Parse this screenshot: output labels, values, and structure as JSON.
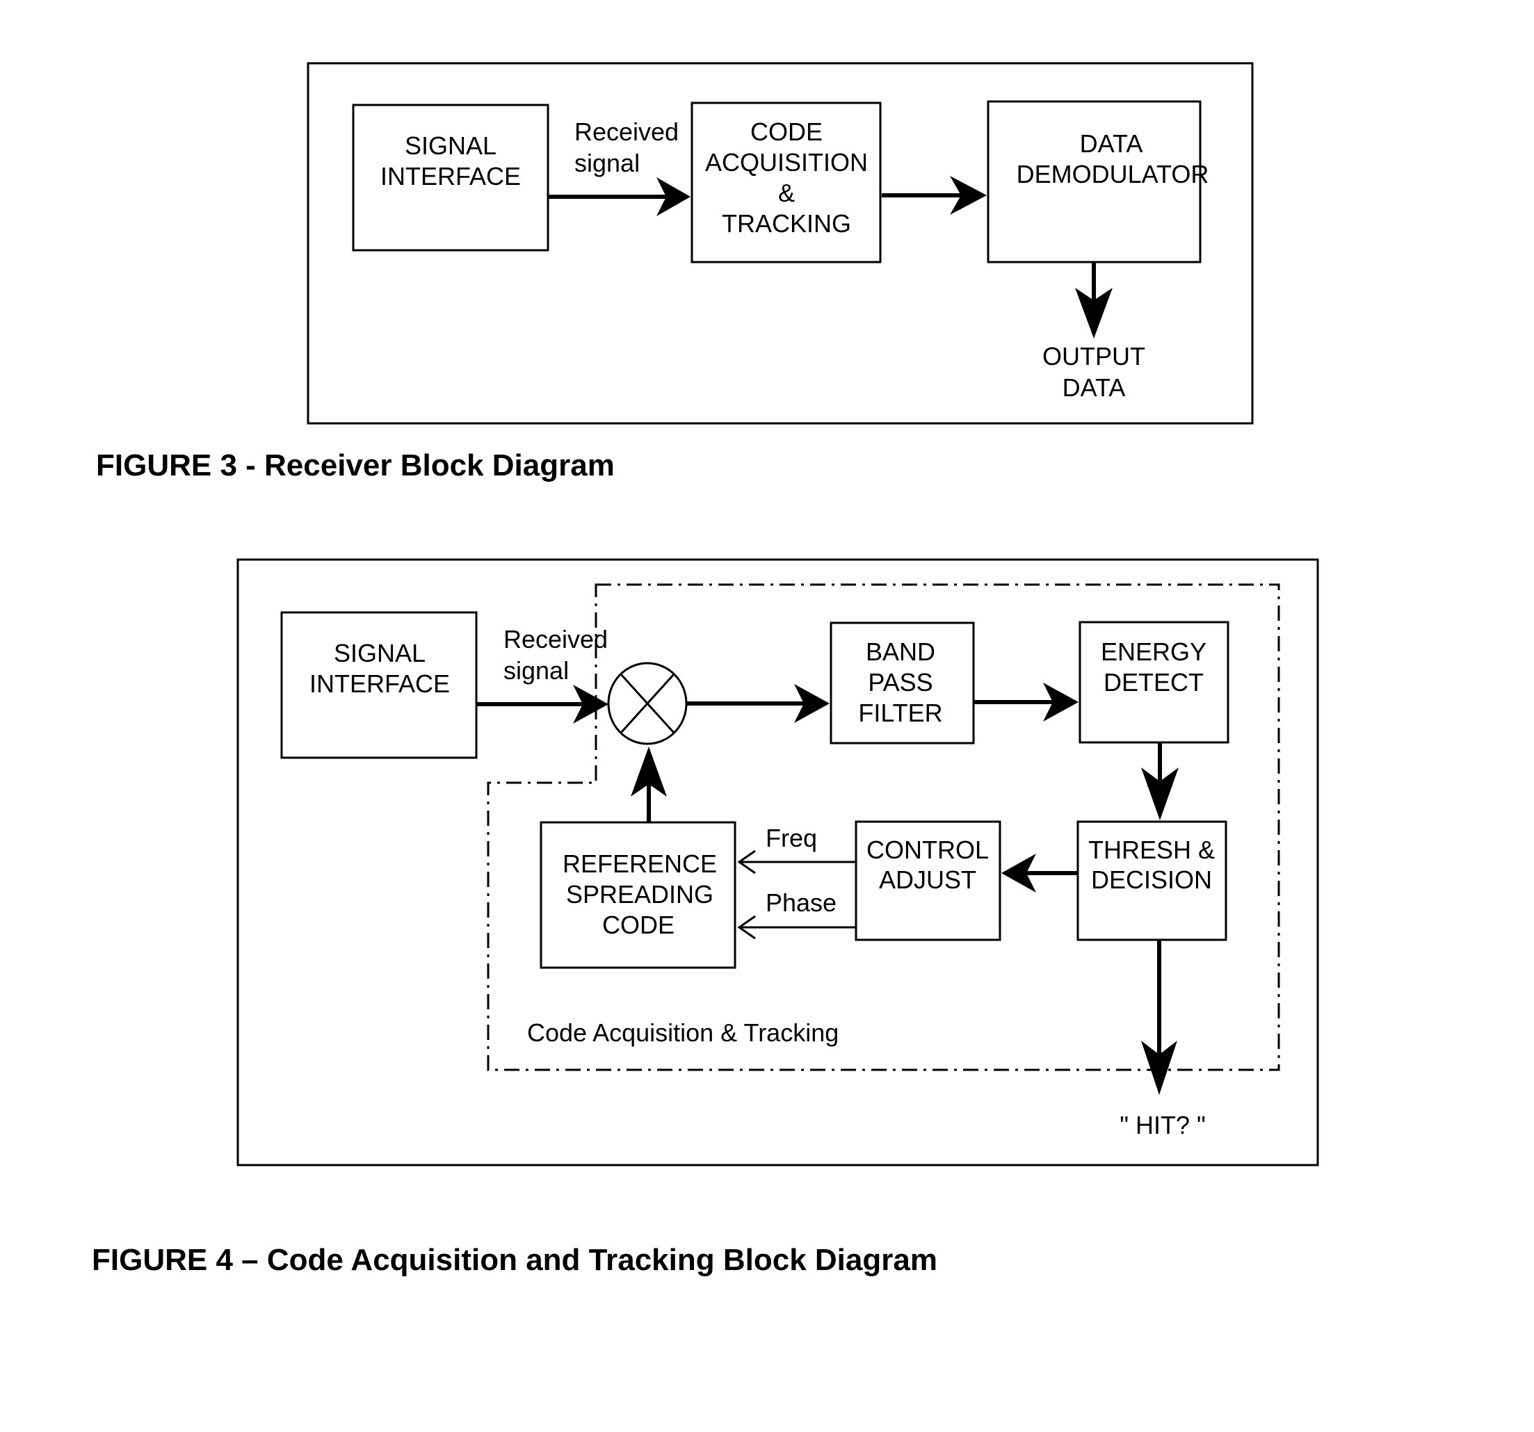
{
  "figure3": {
    "caption": "FIGURE 3 - Receiver Block Diagram",
    "blocks": {
      "signal_interface": [
        "SIGNAL",
        "INTERFACE"
      ],
      "code_acquisition": [
        "CODE",
        "ACQUISITION",
        "&",
        "TRACKING"
      ],
      "data_demodulator": [
        "DATA",
        "DEMODULATOR"
      ]
    },
    "edge_labels": {
      "received_signal": [
        "Received",
        "signal"
      ],
      "output_data": [
        "OUTPUT",
        "DATA"
      ]
    }
  },
  "figure4": {
    "caption": "FIGURE 4 – Code Acquisition and Tracking Block Diagram",
    "group_label": "Code Acquisition & Tracking",
    "blocks": {
      "signal_interface": [
        "SIGNAL",
        "INTERFACE"
      ],
      "band_pass_filter": [
        "BAND",
        "PASS",
        "FILTER"
      ],
      "energy_detect": [
        "ENERGY",
        "DETECT"
      ],
      "thresh_decision": [
        "THRESH &",
        "DECISION"
      ],
      "control_adjust": [
        "CONTROL",
        "ADJUST"
      ],
      "reference_spreading_code": [
        "REFERENCE",
        "SPREADING",
        "CODE"
      ]
    },
    "mixer_symbol": "multiplier",
    "edge_labels": {
      "received_signal": [
        "Received",
        "signal"
      ],
      "freq": "Freq",
      "phase": "Phase",
      "output": "\" HIT? \""
    }
  }
}
